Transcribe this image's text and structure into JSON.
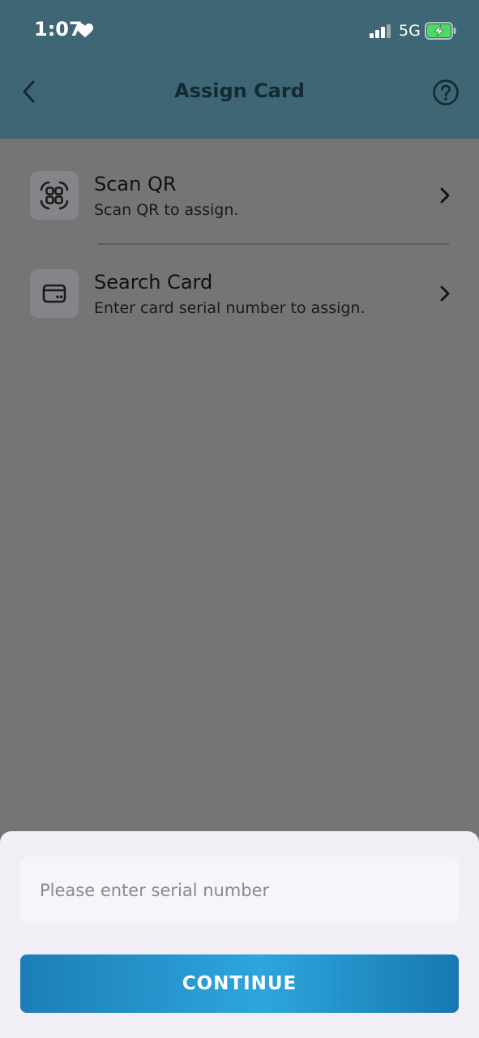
{
  "status_bar": {
    "time": "1:07",
    "network": "5G"
  },
  "header": {
    "title": "Assign Card"
  },
  "options": [
    {
      "label": "Scan QR",
      "description": "Scan QR to assign.",
      "icon": "qr-scan-icon"
    },
    {
      "label": "Search Card",
      "description": "Enter card serial number to assign.",
      "icon": "card-icon"
    }
  ],
  "sheet": {
    "input_placeholder": "Please enter serial number",
    "input_value": "",
    "continue_label": "CONTINUE"
  },
  "colors": {
    "header_bg": "#3f6674",
    "overlay": "#757575",
    "button_gradient": [
      "#1d7eb6",
      "#2ea5dd",
      "#1778b0"
    ],
    "battery": "#4cd964"
  }
}
